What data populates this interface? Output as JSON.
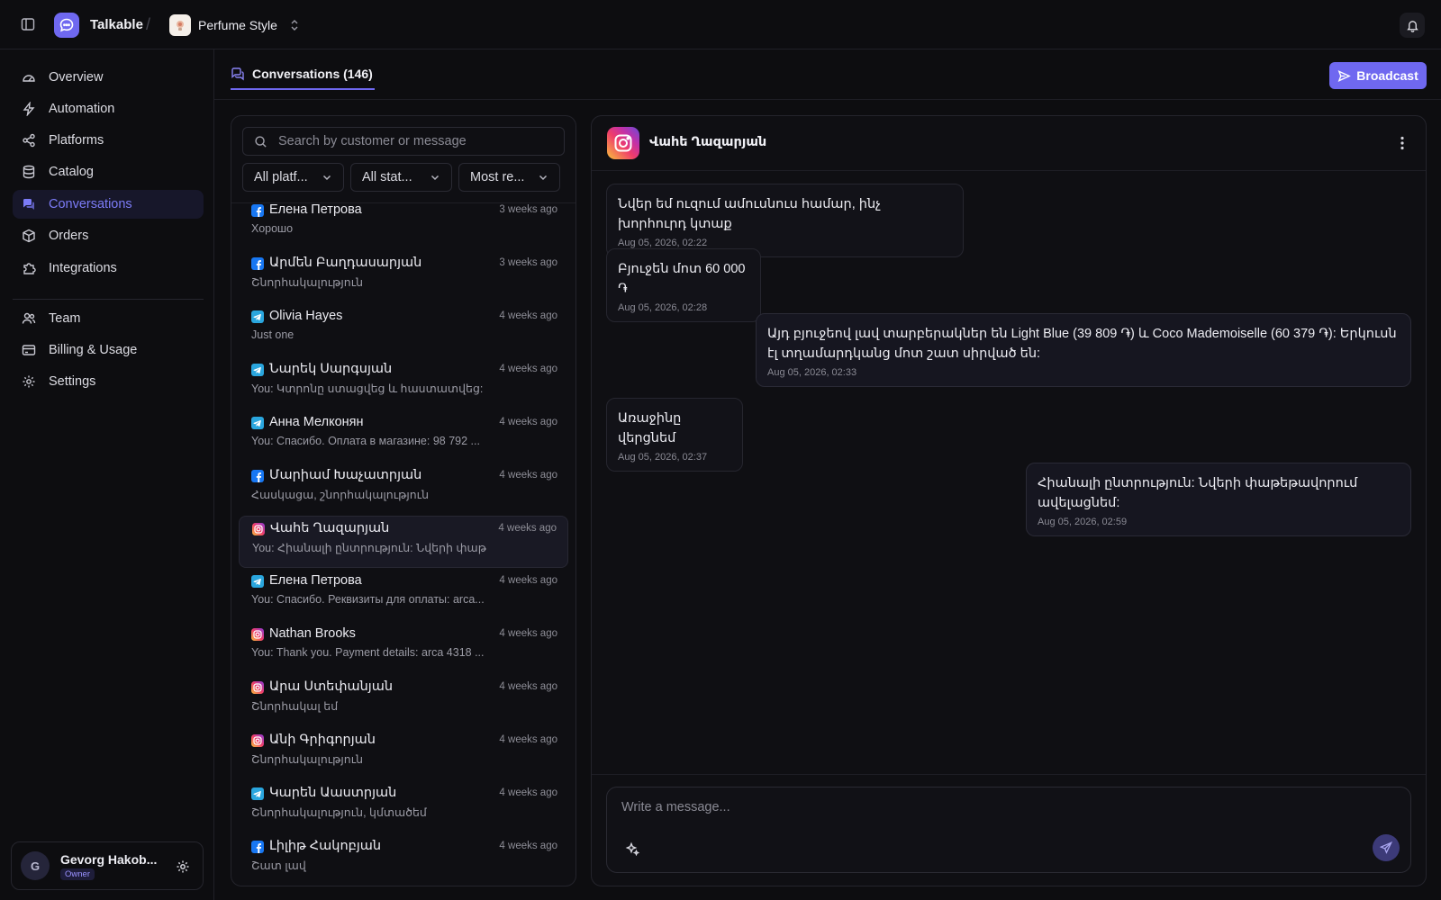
{
  "app": {
    "name": "Talkable",
    "store": "Perfume Style",
    "separator": "/"
  },
  "colors": {
    "accent": "#6f68f0",
    "facebook": "#1877f2",
    "telegram": "#2aa6de",
    "instagram": "#e1306c"
  },
  "sidebar": {
    "items": [
      {
        "label": "Overview",
        "icon": "dashboard-icon"
      },
      {
        "label": "Automation",
        "icon": "bolt-icon"
      },
      {
        "label": "Platforms",
        "icon": "share-icon"
      },
      {
        "label": "Catalog",
        "icon": "database-icon"
      },
      {
        "label": "Conversations",
        "icon": "chat-icon",
        "active": true
      },
      {
        "label": "Orders",
        "icon": "box-icon"
      },
      {
        "label": "Integrations",
        "icon": "puzzle-icon"
      },
      {
        "label": "Team",
        "icon": "users-icon"
      },
      {
        "label": "Billing & Usage",
        "icon": "card-icon"
      },
      {
        "label": "Settings",
        "icon": "gear-icon"
      }
    ]
  },
  "user": {
    "initial": "G",
    "name": "Gevorg Hakob...",
    "role": "Owner"
  },
  "header": {
    "tab_label": "Conversations (146)",
    "broadcast_label": "Broadcast"
  },
  "list": {
    "search_placeholder": "Search by customer or message",
    "filters": [
      "All platf...",
      "All stat...",
      "Most re..."
    ],
    "conversations": [
      {
        "platform": "facebook",
        "name": "Елена Петрова",
        "time": "3 weeks ago",
        "preview": "Хорошо"
      },
      {
        "platform": "facebook",
        "name": "Արմեն Բաղդասարյան",
        "time": "3 weeks ago",
        "preview": "Շնորհակալություն"
      },
      {
        "platform": "telegram",
        "name": "Olivia Hayes",
        "time": "4 weeks ago",
        "preview": "Just one"
      },
      {
        "platform": "telegram",
        "name": "Նարեկ Սարգսյան",
        "time": "4 weeks ago",
        "preview": "You: Կտրոնը ստացվեց և հաստատվեց: Շ..."
      },
      {
        "platform": "telegram",
        "name": "Анна Мелконян",
        "time": "4 weeks ago",
        "preview": "You: Спасибо. Оплата в магазине: 98 792 ..."
      },
      {
        "platform": "facebook",
        "name": "Մարիամ Խաչատրյան",
        "time": "4 weeks ago",
        "preview": "Հասկացա, շնորհակալություն"
      },
      {
        "platform": "instagram",
        "name": "Վահե Ղազարյան",
        "time": "4 weeks ago",
        "preview": "You: Հիանալի ընտրություն: Նվերի փաթեթ...",
        "active": true
      },
      {
        "platform": "telegram",
        "name": "Елена Петрова",
        "time": "4 weeks ago",
        "preview": "You: Спасибо. Реквизиты для оплаты: arca..."
      },
      {
        "platform": "instagram",
        "name": "Nathan Brooks",
        "time": "4 weeks ago",
        "preview": "You: Thank you. Payment details: arca 4318 ..."
      },
      {
        "platform": "instagram",
        "name": "Արա Ստեփանյան",
        "time": "4 weeks ago",
        "preview": "Շնորհակալ եմ"
      },
      {
        "platform": "instagram",
        "name": "Անի Գրիգորյան",
        "time": "4 weeks ago",
        "preview": "Շնորհակալություն"
      },
      {
        "platform": "telegram",
        "name": "Կարեն Աաստրյան",
        "time": "4 weeks ago",
        "preview": "Շնորհակալություն, կմտածեմ"
      },
      {
        "platform": "facebook",
        "name": "Լիլիթ Հակոբյան",
        "time": "4 weeks ago",
        "preview": "Շատ լավ"
      }
    ]
  },
  "chat": {
    "contact_name": "Վահե Ղազարյան",
    "platform": "instagram",
    "messages": [
      {
        "direction": "in",
        "text": "Նվեր եմ ուզում ամուսնուս համար, ինչ խորհուրդ կտաք",
        "time": "Aug 05, 2026, 02:22"
      },
      {
        "direction": "in",
        "text": "Բյուջեն մոտ 60 000 ֏",
        "time": "Aug 05, 2026, 02:28"
      },
      {
        "direction": "out",
        "text": "Այդ բյուջեով լավ տարբերակներ են Light Blue (39 809 ֏) և Coco Mademoiselle (60 379 ֏): Երկուսն էլ տղամարդկանց մոտ շատ սիրված են:",
        "time": "Aug 05, 2026, 02:33"
      },
      {
        "direction": "in",
        "text": "Առաջինը վերցնեմ",
        "time": "Aug 05, 2026, 02:37"
      },
      {
        "direction": "out",
        "text": "Հիանալի ընտրություն: Նվերի փաթեթավորում ավելացնեմ:",
        "time": "Aug 05, 2026, 02:59"
      }
    ],
    "composer_placeholder": "Write a message..."
  }
}
